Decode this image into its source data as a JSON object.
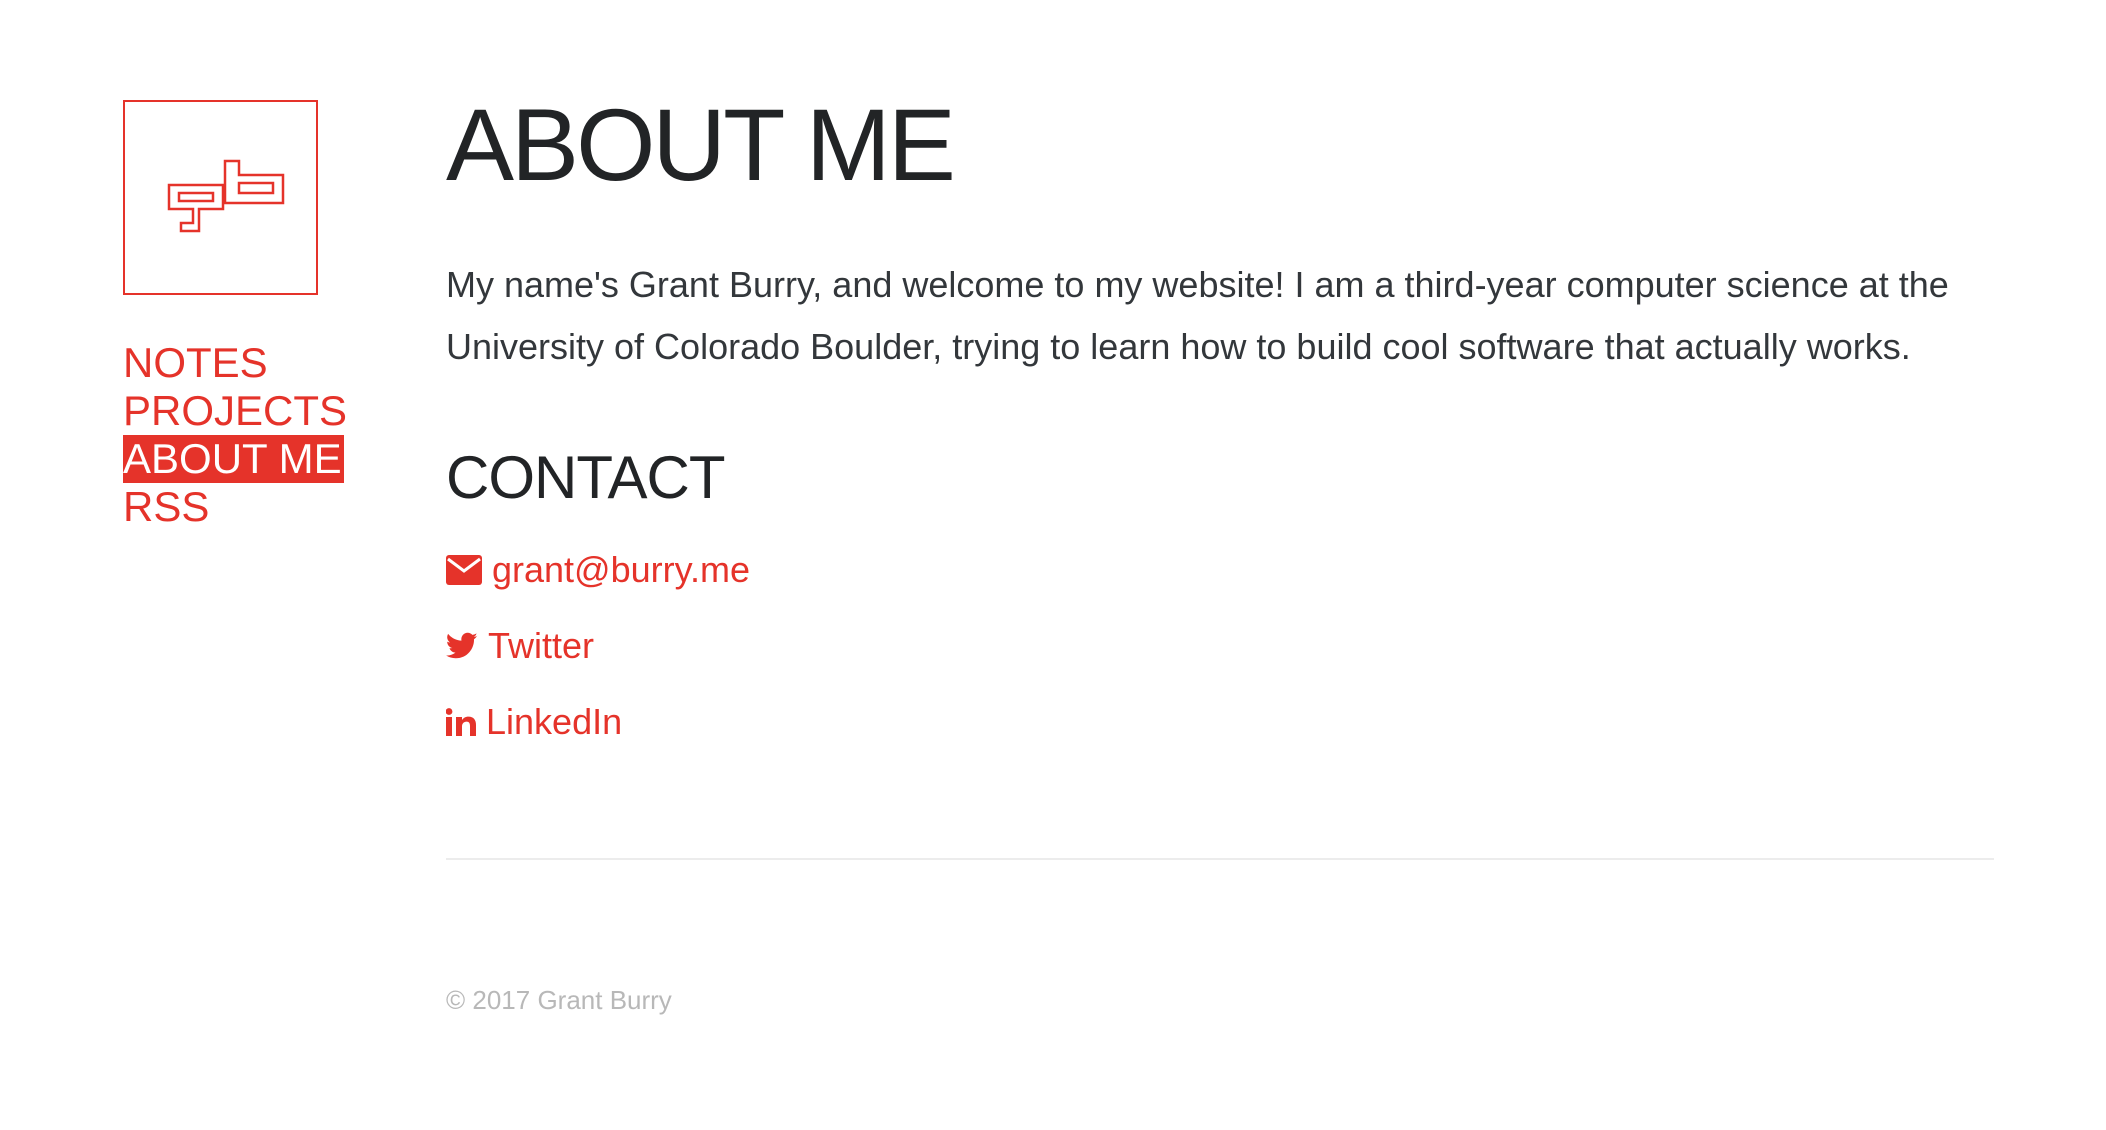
{
  "sidebar": {
    "logo_alt": "gb",
    "nav": [
      {
        "label": "NOTES"
      },
      {
        "label": "PROJECTS"
      },
      {
        "label": "ABOUT ME"
      },
      {
        "label": "RSS"
      }
    ],
    "active_index": 2
  },
  "main": {
    "title": "ABOUT ME",
    "bio": "My name's Grant Burry, and welcome to my website! I am a third-year computer science at the University of Colorado Boulder, trying to learn how to build cool software that actually works.",
    "contact_title": "CONTACT",
    "contacts": [
      {
        "icon": "envelope-icon",
        "label": "grant@burry.me"
      },
      {
        "icon": "twitter-icon",
        "label": "Twitter"
      },
      {
        "icon": "linkedin-icon",
        "label": "LinkedIn"
      }
    ]
  },
  "footer": {
    "text": "© 2017 Grant Burry"
  },
  "colors": {
    "accent": "#e5332a",
    "heading": "#222426",
    "body_text": "#33373b",
    "footer_text": "#b8b8b8",
    "divider": "#ececec"
  }
}
